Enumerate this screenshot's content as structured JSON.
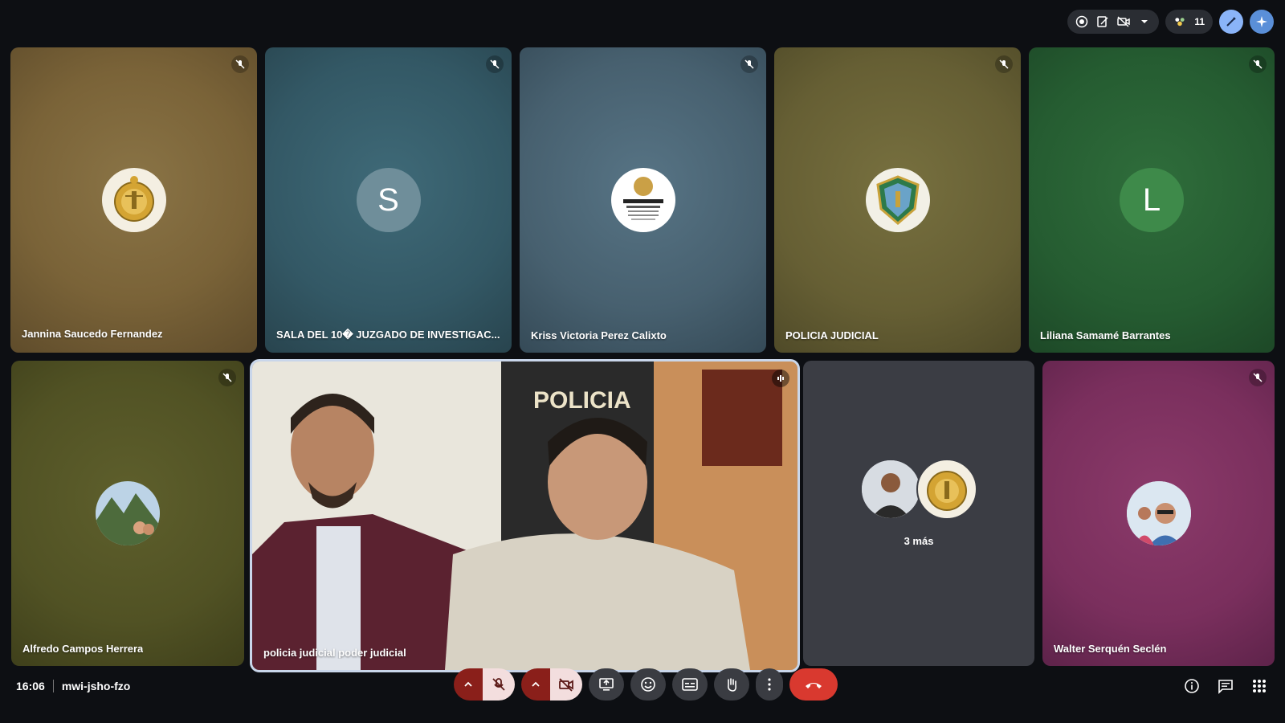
{
  "top_bar": {
    "participant_count": "11"
  },
  "tiles": [
    {
      "name": "Jannina Saucedo Fernandez",
      "avatar_type": "seal-poder-judicial"
    },
    {
      "name": "SALA DEL 10� JUZGADO DE INVESTIGAC...",
      "avatar_letter": "S"
    },
    {
      "name": "Kriss Victoria Perez Calixto",
      "avatar_type": "ministerio-publico-logo"
    },
    {
      "name": "POLICIA JUDICIAL",
      "avatar_type": "policia-judicial-shield"
    },
    {
      "name": "Liliana Samamé Barrantes",
      "avatar_letter": "L"
    },
    {
      "name": "Alfredo Campos Herrera",
      "avatar_type": "photo-machu-picchu"
    },
    {
      "name": "policia judicial poder judicial",
      "avatar_type": "live-video"
    },
    {
      "more_label": "3 más"
    },
    {
      "name": "Walter Serquén Seclén",
      "avatar_type": "photo-selfie"
    }
  ],
  "bottom_bar": {
    "time": "16:06",
    "meeting_code": "mwi-jsho-fzo"
  }
}
